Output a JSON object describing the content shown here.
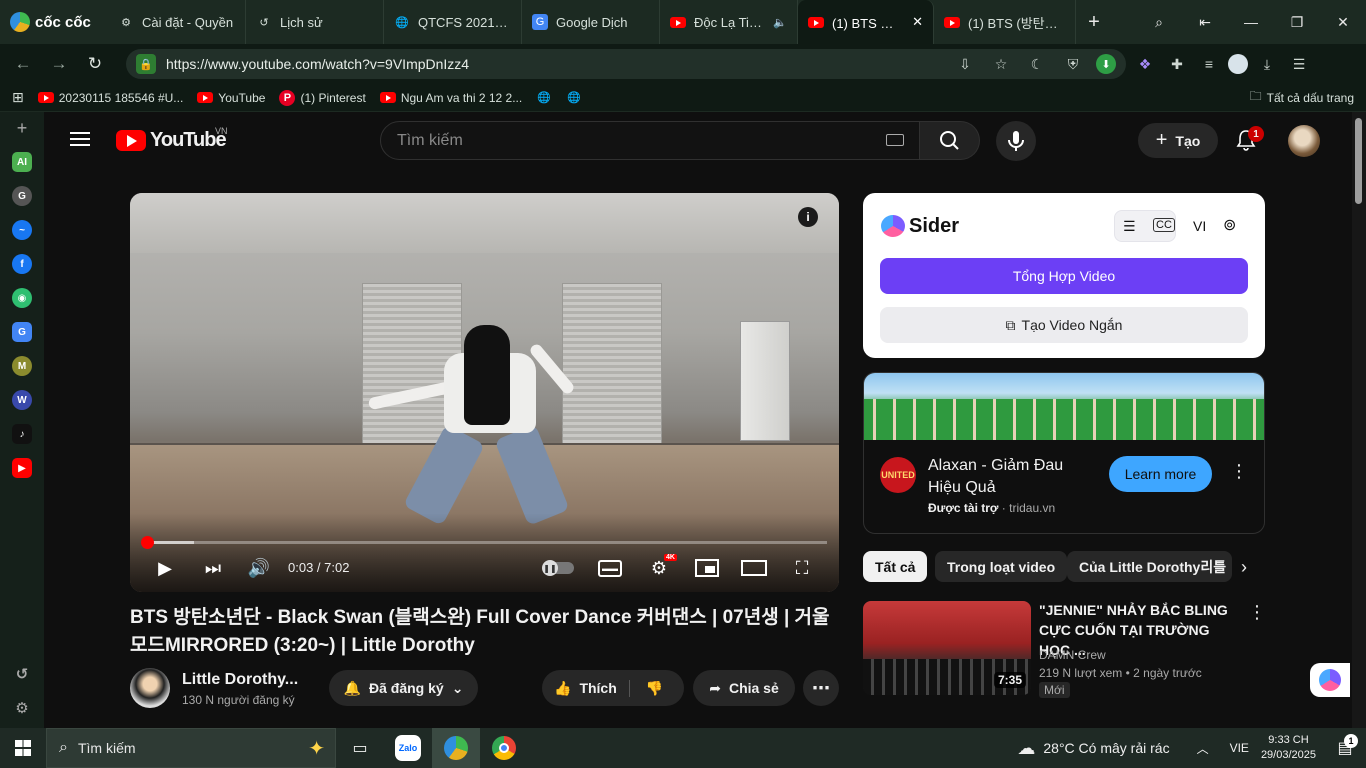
{
  "browser": {
    "brand": "cốc cốc",
    "tabs": [
      {
        "label": "Cài đặt - Quyền",
        "icon": "gear-icon"
      },
      {
        "label": "Lịch sử",
        "icon": "history-icon"
      },
      {
        "label": "QTCFS 2021-202",
        "icon": "globe-icon"
      },
      {
        "label": "Google Dịch",
        "icon": "google-translate-icon"
      },
      {
        "label": "Độc Lạ Tiệm",
        "icon": "youtube-icon"
      },
      {
        "label": "(1) BTS 방탄",
        "icon": "youtube-icon"
      },
      {
        "label": "(1) BTS (방탄소년",
        "icon": "youtube-icon"
      }
    ],
    "url": "https://www.youtube.com/watch?v=9VImpDnIzz4",
    "bookmarks": [
      {
        "label": "20230115 185546 #U...",
        "icon": "youtube-icon"
      },
      {
        "label": "YouTube",
        "icon": "youtube-icon"
      },
      {
        "label": "(1) Pinterest",
        "icon": "pinterest-icon"
      },
      {
        "label": "Ngu Am va thi 2 12 2...",
        "icon": "youtube-icon"
      }
    ],
    "all_bookmarks": "Tất cả dấu trang",
    "sidebar_icons": [
      "AI",
      "G",
      "M",
      "W"
    ]
  },
  "youtube": {
    "logo_text": "YouTube",
    "country": "VN",
    "search_placeholder": "Tìm kiếm",
    "create_label": "Tạo",
    "notif_count": "1",
    "player": {
      "time": "0:03 / 7:02",
      "quality_badge": "4K",
      "progress": 0.0071
    },
    "video": {
      "title": "BTS 방탄소년단 - Black Swan (블랙스완) Full Cover Dance 커버댄스 | 07년생 | 거울모드MIRRORED (3:20~) | Little Dorothy",
      "channel": "Little Dorothy...",
      "subscribers": "130 N người đăng ký",
      "subscribed_label": "Đã đăng ký",
      "like_label": "Thích",
      "share_label": "Chia sẻ"
    },
    "sider": {
      "name": "Sider",
      "lang": "VI",
      "summary_button": "Tổng Hợp Video",
      "short_button": "Tạo Video Ngắn"
    },
    "ad": {
      "title": "Alaxan - Giảm Đau Hiệu Quả",
      "sponsored": "Được tài trợ",
      "domain": "tridau.vn",
      "cta": "Learn more",
      "logo_text": "UNITED"
    },
    "chips": [
      "Tất cả",
      "Trong loạt video",
      "Của Little Dorothy리틀"
    ],
    "related": [
      {
        "title": "\"JENNIE\" NHẢY BẮC BLING CỰC CUỐN TẠI TRƯỜNG HỌC ...",
        "channel": "DAMN Crew",
        "views": "219 N lượt xem",
        "age": "2 ngày trước",
        "badge": "Mới",
        "duration": "7:35"
      }
    ]
  },
  "taskbar": {
    "search_placeholder": "Tìm kiếm",
    "weather": "28°C  Có mây rải rác",
    "lang": "VIE",
    "time": "9:33 CH",
    "date": "29/03/2025",
    "notif_badge": "1"
  },
  "colors": {
    "yt_red": "#ff0000",
    "sider_purple": "#6c3ff5",
    "learn_blue": "#3ea6ff"
  }
}
